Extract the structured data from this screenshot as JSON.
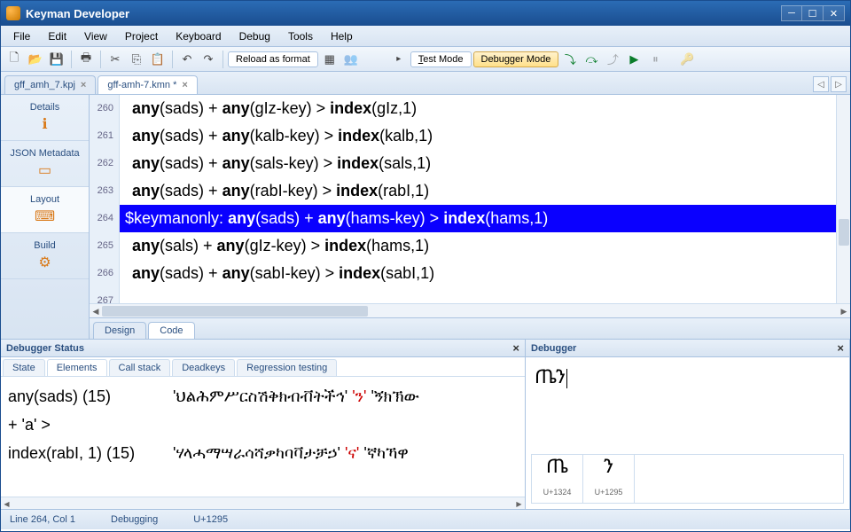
{
  "window": {
    "title": "Keyman Developer"
  },
  "menu": [
    "File",
    "Edit",
    "View",
    "Project",
    "Keyboard",
    "Debug",
    "Tools",
    "Help"
  ],
  "toolbar": {
    "reload_label": "Reload as format",
    "test_mode_label": "Test Mode",
    "debugger_mode_label": "Debugger Mode"
  },
  "file_tabs": [
    {
      "label": "gff_amh_7.kpj",
      "active": false
    },
    {
      "label": "gff-amh-7.kmn *",
      "active": true
    }
  ],
  "sidebar": {
    "items": [
      {
        "label": "Details",
        "icon": "ℹ"
      },
      {
        "label": "JSON Metadata",
        "icon": "▭"
      },
      {
        "label": "Layout",
        "icon": "⌨"
      },
      {
        "label": "Build",
        "icon": "⚙"
      }
    ]
  },
  "editor": {
    "lines": [
      {
        "num": "260",
        "b1": "any",
        "a1": "(sads) + ",
        "b2": "any",
        "a2": "(gIz-key)  > ",
        "b3": "index",
        "a3": "(gIz,1)"
      },
      {
        "num": "261",
        "b1": "any",
        "a1": "(sads) + ",
        "b2": "any",
        "a2": "(kalb-key) > ",
        "b3": "index",
        "a3": "(kalb,1)"
      },
      {
        "num": "262",
        "b1": "any",
        "a1": "(sads) + ",
        "b2": "any",
        "a2": "(sals-key) > ",
        "b3": "index",
        "a3": "(sals,1)"
      },
      {
        "num": "263",
        "b1": "any",
        "a1": "(sads) + ",
        "b2": "any",
        "a2": "(rabI-key) > ",
        "b3": "index",
        "a3": "(rabI,1)"
      },
      {
        "num": "264",
        "pre": "$keymanonly: ",
        "b1": "any",
        "a1": "(sads) + ",
        "b2": "any",
        "a2": "(hams-key) > ",
        "b3": "index",
        "a3": "(hams,1)",
        "highlight": true
      },
      {
        "num": "265",
        "b1": "any",
        "a1": "(sals) + ",
        "b2": "any",
        "a2": "(gIz-key)  > ",
        "b3": "index",
        "a3": "(hams,1)"
      },
      {
        "num": "266",
        "b1": "any",
        "a1": "(sads) + ",
        "b2": "any",
        "a2": "(sabI-key) > ",
        "b3": "index",
        "a3": "(sabI,1)"
      }
    ],
    "last_line_num": "267",
    "corner_tabs": {
      "design": "Design",
      "code": "Code"
    }
  },
  "debugger_status": {
    "title": "Debugger Status",
    "tabs": [
      "State",
      "Elements",
      "Call stack",
      "Deadkeys",
      "Regression testing"
    ],
    "active_tab": "Elements",
    "rows": [
      {
        "key": "any(sads) (15)",
        "val": "'ህልሕምሥርስሽቅክብቭትችኅ'",
        "red": "'ን'",
        "tail": " 'ኝክኽው"
      },
      {
        "key": "+ 'a' >",
        "val": "",
        "red": "",
        "tail": ""
      },
      {
        "key": "index(rabI, 1) (15)",
        "val": "'ሃላሓማሣራሳሻቃካባቫታቻኃ'",
        "red": "'ና'",
        "tail": " 'ኛካኻዋ"
      }
    ]
  },
  "debugger": {
    "title": "Debugger",
    "typed": "ጤን",
    "glyphs": [
      {
        "g": "ጤ",
        "cp": "U+1324"
      },
      {
        "g": "ን",
        "cp": "U+1295"
      }
    ]
  },
  "status": {
    "pos": "Line 264, Col 1",
    "mode": "Debugging",
    "codepoint": "U+1295"
  }
}
